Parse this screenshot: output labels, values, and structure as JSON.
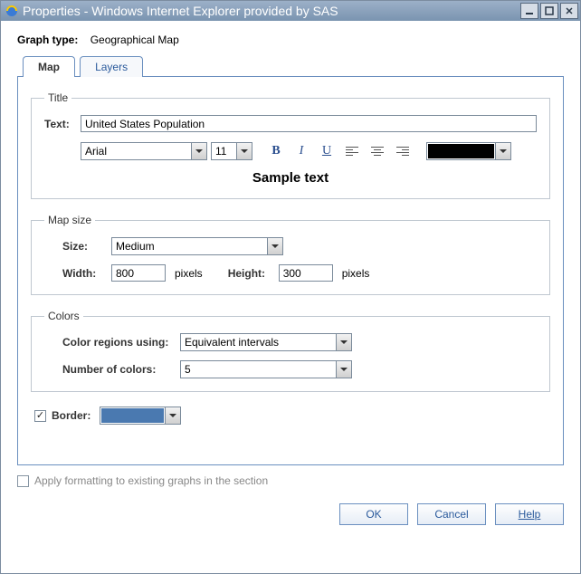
{
  "window": {
    "title": "Properties - Windows Internet Explorer provided by SAS"
  },
  "header": {
    "graph_type_label": "Graph type:",
    "graph_type_value": "Geographical Map"
  },
  "tabs": {
    "map": "Map",
    "layers": "Layers"
  },
  "title_section": {
    "legend": "Title",
    "text_label": "Text:",
    "text_value": "United States Population",
    "font_family": "Arial",
    "font_size": "11",
    "sample_text": "Sample text",
    "text_color": "#000000"
  },
  "map_size": {
    "legend": "Map size",
    "size_label": "Size:",
    "size_value": "Medium",
    "width_label": "Width:",
    "width_value": "800",
    "height_label": "Height:",
    "height_value": "300",
    "pixels_label": "pixels"
  },
  "colors": {
    "legend": "Colors",
    "color_regions_label": "Color regions using:",
    "color_regions_value": "Equivalent intervals",
    "num_colors_label": "Number of colors:",
    "num_colors_value": "5"
  },
  "border": {
    "label": "Border:",
    "color": "#4a79b0"
  },
  "apply_label": "Apply formatting to existing graphs in the section",
  "buttons": {
    "ok": "OK",
    "cancel": "Cancel",
    "help": "Help"
  }
}
